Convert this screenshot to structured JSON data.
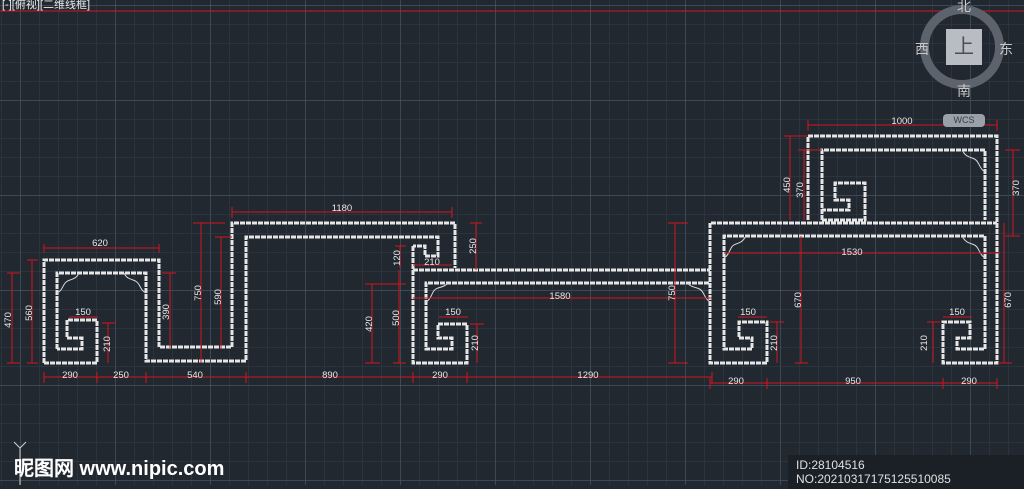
{
  "viewport": {
    "label": "[-][俯视][二维线框]"
  },
  "viewcube": {
    "north": "北",
    "south": "南",
    "west": "西",
    "east": "东",
    "face": "上",
    "wcs": "WCS"
  },
  "dimensions": {
    "left": {
      "width_620": "620",
      "h_470": "470",
      "h_560": "560",
      "w_150": "150",
      "h_210": "210",
      "h_390": "390"
    },
    "middle": {
      "w_1180": "1180",
      "h_750": "750",
      "h_590": "590",
      "h_250": "250",
      "h_120": "120",
      "w_210": "210",
      "h_500": "500",
      "h_420": "420",
      "w_150": "150",
      "h_210": "210",
      "w_1580": "1580",
      "h_750b": "750"
    },
    "right": {
      "w_1000": "1000",
      "h_450": "450",
      "h_370": "370",
      "h_370b": "370",
      "w_1530": "1530",
      "h_670": "670",
      "h_670b": "670",
      "w_150a": "150",
      "h_210a": "210",
      "h_210b": "210",
      "w_150b": "150"
    },
    "bottom": [
      "290",
      "250",
      "540",
      "890",
      "290",
      "1290"
    ],
    "bottom_right": [
      "290",
      "950",
      "290"
    ]
  },
  "watermark": {
    "logo": "昵图网 www.nipic.com",
    "id": "ID:28104516 NO:20210317175125510085"
  },
  "colors": {
    "background": "#212830",
    "dimension": "#d2141e",
    "geometry": "#e6e6e6"
  }
}
